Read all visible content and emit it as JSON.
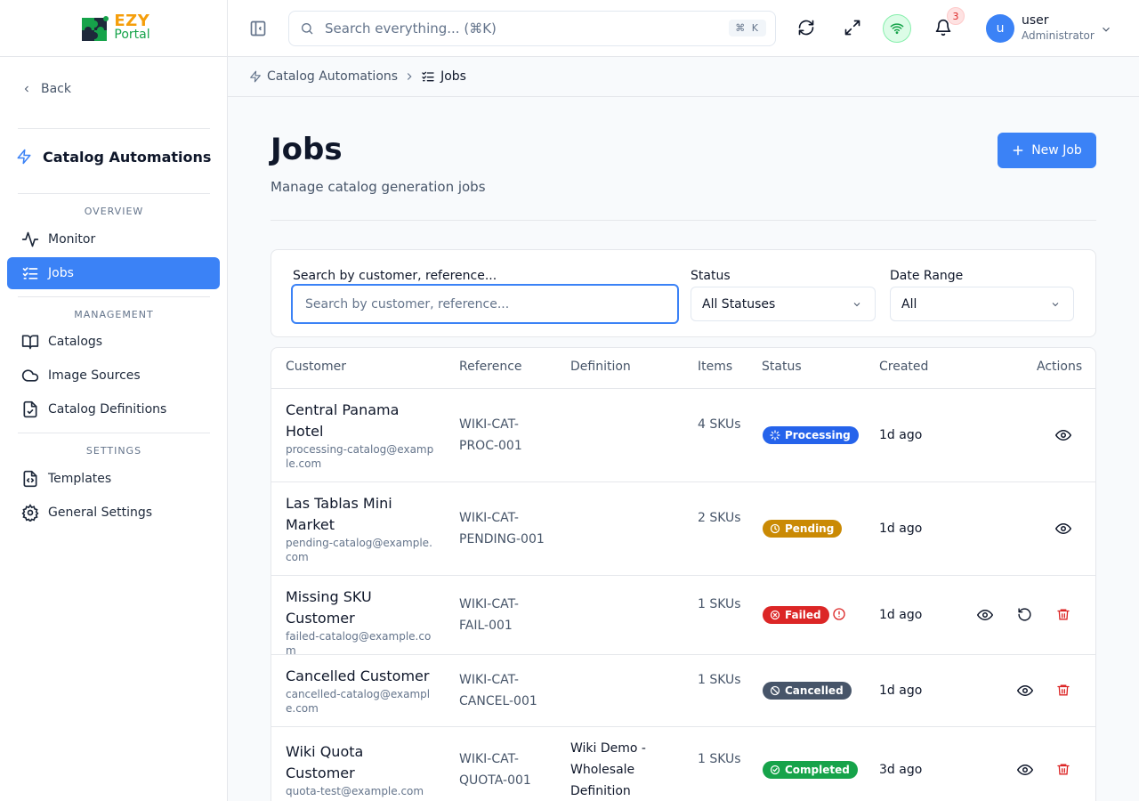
{
  "app": {
    "logo_main": "EZY",
    "logo_sub": "Portal"
  },
  "sidebar": {
    "back_label": "Back",
    "module_title": "Catalog Automations",
    "sections": [
      {
        "label": "OVERVIEW",
        "items": [
          {
            "label": "Monitor",
            "icon": "activity-icon"
          },
          {
            "label": "Jobs",
            "icon": "list-checks-icon",
            "active": true
          }
        ]
      },
      {
        "label": "MANAGEMENT",
        "items": [
          {
            "label": "Catalogs",
            "icon": "book-open-icon"
          },
          {
            "label": "Image Sources",
            "icon": "cloud-icon"
          },
          {
            "label": "Catalog Definitions",
            "icon": "file-check-icon"
          }
        ]
      },
      {
        "label": "SETTINGS",
        "items": [
          {
            "label": "Templates",
            "icon": "file-code-icon"
          },
          {
            "label": "General Settings",
            "icon": "settings-icon"
          }
        ]
      }
    ]
  },
  "header": {
    "search_placeholder": "Search everything... (⌘K)",
    "search_shortcut": "⌘ K",
    "notifications_count": "3",
    "user": {
      "initial": "u",
      "name": "user",
      "role": "Administrator"
    }
  },
  "breadcrumb": {
    "parent": "Catalog Automations",
    "current": "Jobs"
  },
  "page": {
    "title": "Jobs",
    "subtitle": "Manage catalog generation jobs",
    "new_button": "New Job"
  },
  "filters": {
    "search_label": "Search by customer, reference...",
    "search_placeholder": "Search by customer, reference...",
    "status_label": "Status",
    "status_value": "All Statuses",
    "date_label": "Date Range",
    "date_value": "All"
  },
  "table": {
    "columns": [
      "Customer",
      "Reference",
      "Definition",
      "Items",
      "Status",
      "Created",
      "Actions"
    ],
    "rows": [
      {
        "customer": "Central Panama Hotel",
        "email": "processing-catalog@example.com",
        "reference": "WIKI-CAT-PROC-001",
        "definition": "",
        "items": "4 SKUs",
        "status": "Processing",
        "status_color": "#2563eb",
        "created": "1d ago"
      },
      {
        "customer": "Las Tablas Mini Market",
        "email": "pending-catalog@example.com",
        "reference": "WIKI-CAT-PENDING-001",
        "definition": "",
        "items": "2 SKUs",
        "status": "Pending",
        "status_color": "#ca8a04",
        "created": "1d ago"
      },
      {
        "customer": "Missing SKU Customer",
        "email": "failed-catalog@example.com",
        "reference": "WIKI-CAT-FAIL-001",
        "definition": "",
        "items": "1 SKUs",
        "status": "Failed",
        "status_color": "#dc2626",
        "created": "1d ago"
      },
      {
        "customer": "Cancelled Customer",
        "email": "cancelled-catalog@example.com",
        "reference": "WIKI-CAT-CANCEL-001",
        "definition": "",
        "items": "1 SKUs",
        "status": "Cancelled",
        "status_color": "#475569",
        "created": "1d ago"
      },
      {
        "customer": "Wiki Quota Customer",
        "email": "quota-test@example.com",
        "reference": "WIKI-CAT-QUOTA-001",
        "definition": "Wiki Demo - Wholesale Definition",
        "items": "1 SKUs",
        "status": "Completed",
        "status_color": "#16a34a",
        "created": "3d ago"
      }
    ]
  },
  "colors": {
    "accent": "#3b82f6",
    "logo_orange": "#f59e0b",
    "logo_green": "#16a34a"
  }
}
